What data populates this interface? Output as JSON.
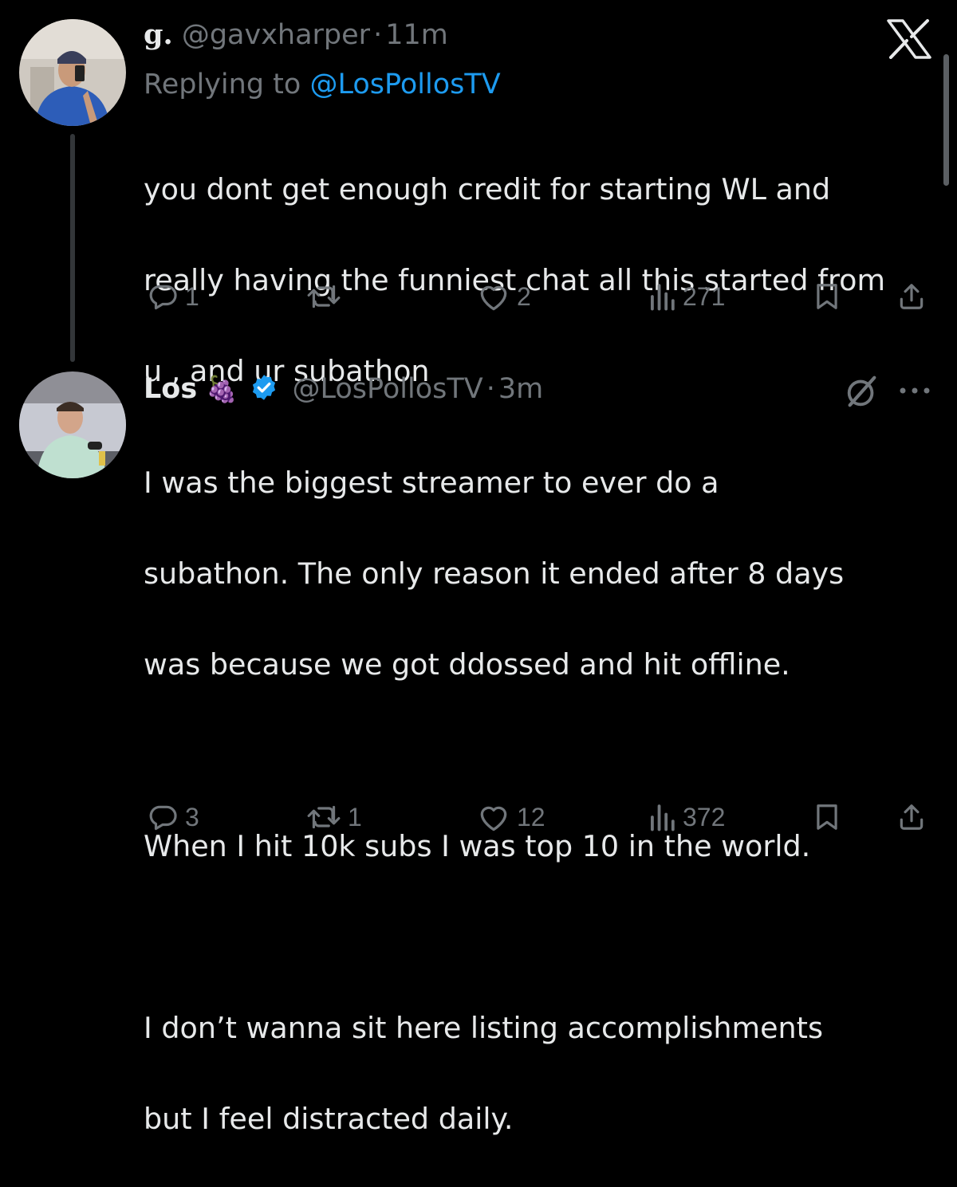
{
  "app": {
    "logo_name": "x-logo"
  },
  "reply_tweet": {
    "display_name": "g.",
    "handle": "@gavxharper",
    "separator": "·",
    "time": "11m",
    "replying_to_prefix": "Replying to",
    "replying_to_handle": "@LosPollosTV",
    "text_lines": [
      "you dont get enough credit for starting WL and",
      "really having the funniest chat all this started from",
      "u , and ur subathon"
    ],
    "actions": {
      "replies": "1",
      "reposts": "",
      "likes": "2",
      "views": "271"
    }
  },
  "main_tweet": {
    "display_name": "Los",
    "name_emoji": "🍇",
    "verified": true,
    "handle": "@LosPollosTV",
    "separator": "·",
    "time": "3m",
    "text_lines": [
      "I was the biggest streamer to ever do a",
      "subathon. The only reason it ended after 8 days",
      "was because we got ddossed and hit offline.",
      "",
      "When I hit 10k subs I was top 10 in the world.",
      "",
      "I don’t wanna sit here listing accomplishments",
      "but I feel distracted daily."
    ],
    "actions": {
      "replies": "3",
      "reposts": "1",
      "likes": "12",
      "views": "372"
    }
  },
  "colors": {
    "background": "#000000",
    "text": "#e7e9ea",
    "muted": "#71767b",
    "link": "#1d9bf0",
    "verified": "#1d9bf0"
  }
}
